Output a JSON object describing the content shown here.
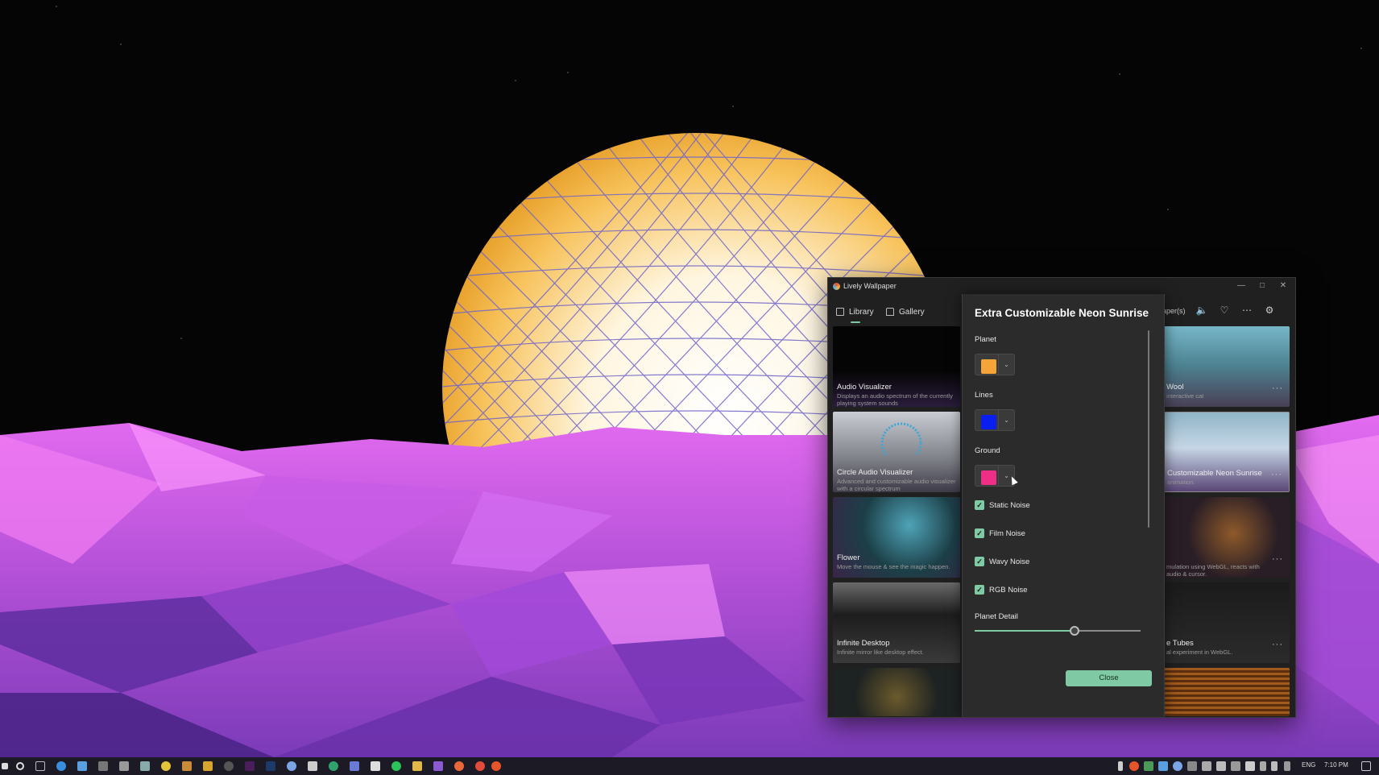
{
  "window": {
    "title": "Lively Wallpaper",
    "minimize_label": "—",
    "maximize_label": "□",
    "close_label": "✕"
  },
  "nav": {
    "tabs": [
      {
        "label": "Library",
        "active": true
      },
      {
        "label": "Gallery",
        "active": false
      }
    ],
    "partial_text": "aper(s)"
  },
  "library": {
    "left_cards": [
      {
        "title": "Audio Visualizer",
        "desc": "Displays an audio spectrum of the currently playing system sounds"
      },
      {
        "title": "Circle Audio Visualizer",
        "desc": "Advanced and customizable audio visualizer with a circular spectrum"
      },
      {
        "title": "Flower",
        "desc": "Move the mouse & see the magic happen."
      },
      {
        "title": "Infinite Desktop",
        "desc": "Infinite mirror like desktop effect."
      }
    ],
    "right_cards": [
      {
        "title": "Wool",
        "desc": "interactive cat"
      },
      {
        "title": "Customizable Neon Sunrise",
        "desc": "animation."
      },
      {
        "title": "",
        "desc": "mulation using WebGL, reacts with audio & cursor."
      },
      {
        "title": "e Tubes",
        "desc": "al experiment in WebGL."
      }
    ],
    "more_label": "···"
  },
  "panel": {
    "title": "Extra Customizable Neon Sunrise",
    "colors": [
      {
        "label": "Planet",
        "value": "#f5a43a"
      },
      {
        "label": "Lines",
        "value": "#0a1ef0"
      },
      {
        "label": "Ground",
        "value": "#ef2f86"
      }
    ],
    "dropdown_glyph": "⌄",
    "checkboxes": [
      {
        "label": "Static Noise",
        "checked": true
      },
      {
        "label": "Film Noise",
        "checked": true
      },
      {
        "label": "Wavy Noise",
        "checked": true
      },
      {
        "label": "RGB Noise",
        "checked": true
      }
    ],
    "check_glyph": "✓",
    "slider": {
      "label": "Planet Detail",
      "value": 0.6
    },
    "close_label": "Close"
  },
  "taskbar": {
    "language": "ENG",
    "time": "7:10 PM"
  },
  "colors": {
    "accent": "#7fc9a4",
    "panel_bg": "#2b2b2b",
    "window_bg": "#202020"
  }
}
